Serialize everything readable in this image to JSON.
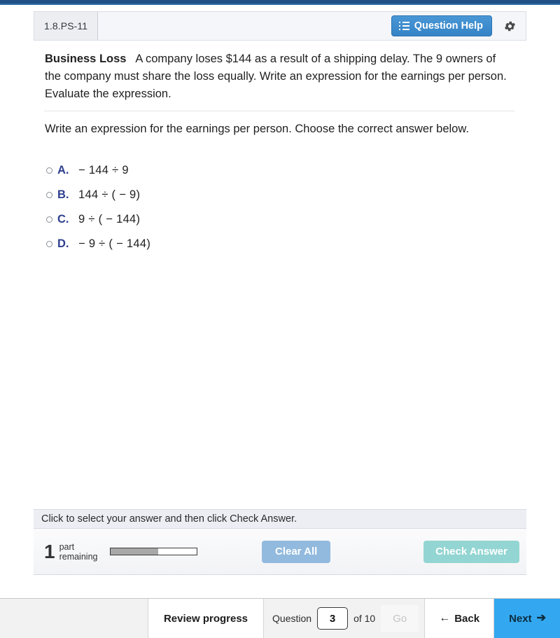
{
  "header": {
    "question_id": "1.8.PS-11",
    "question_help_label": "Question Help",
    "list_icon": "list-icon",
    "gear_icon": "gear-icon"
  },
  "question": {
    "stem_title": "Business Loss",
    "stem_text": "A company loses $144 as a result of a shipping delay. The 9 owners of the company must share the loss equally. Write an expression for the earnings per person. Evaluate the expression.",
    "prompt": "Write an expression for the earnings per person. Choose the correct answer below.",
    "choices": [
      {
        "letter": "A.",
        "expression": "− 144 ÷ 9"
      },
      {
        "letter": "B.",
        "expression": "144 ÷ ( − 9)"
      },
      {
        "letter": "C.",
        "expression": "9 ÷ ( − 144)"
      },
      {
        "letter": "D.",
        "expression": "− 9 ÷ ( − 144)"
      }
    ]
  },
  "status": {
    "instruction": "Click to select your answer and then click Check Answer.",
    "parts_number": "1",
    "parts_line1": "part",
    "parts_line2": "remaining",
    "progress_percent": 55,
    "clear_all_label": "Clear All",
    "check_answer_label": "Check Answer"
  },
  "bottom_nav": {
    "review_label": "Review progress",
    "question_word": "Question",
    "question_number": "3",
    "of_label": "of 10",
    "go_label": "Go",
    "back_label": "Back",
    "next_label": "Next",
    "back_arrow": "←",
    "next_arrow": "➔"
  },
  "colors": {
    "top_strip": "#1f5185",
    "help_button": "#3e8ed0",
    "choice_letter": "#2f3f8f",
    "clear_button": "#92bade",
    "check_button": "#93d5d2",
    "next_button": "#33a8f0"
  }
}
